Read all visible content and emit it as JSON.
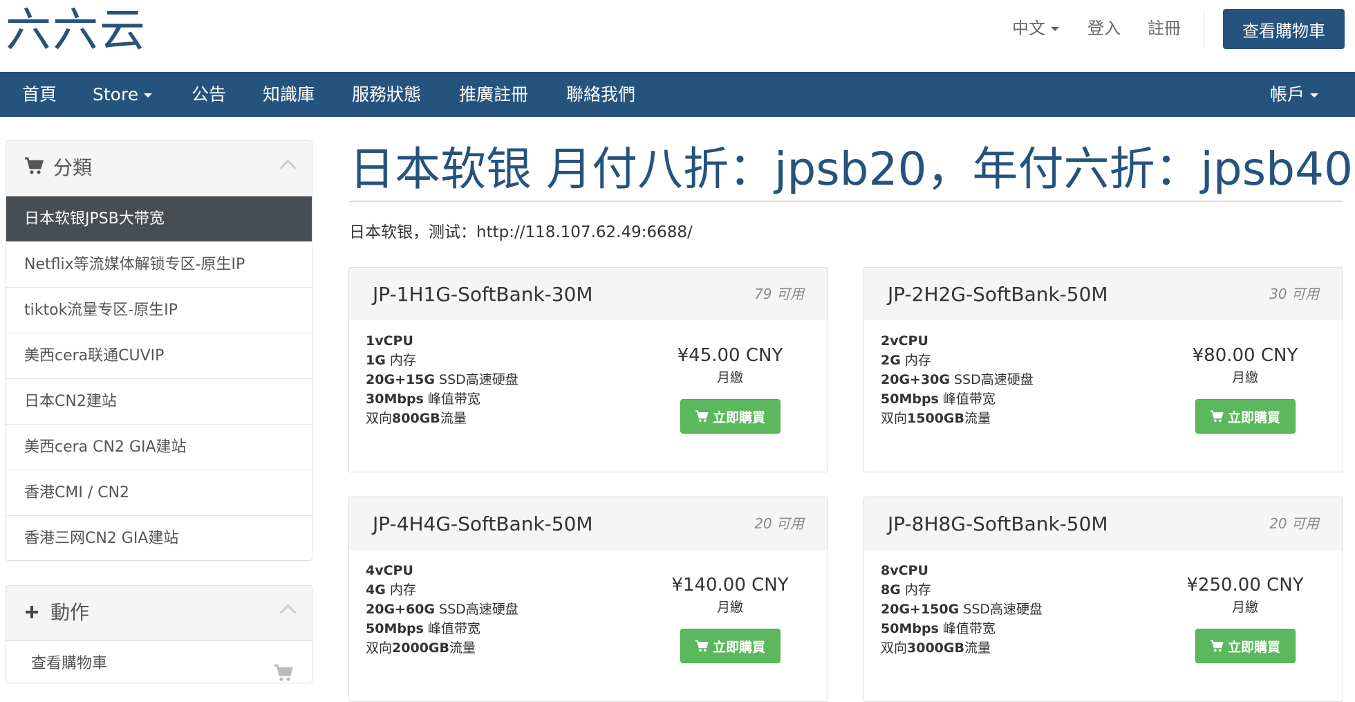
{
  "header": {
    "logo": "六六云",
    "language": "中文",
    "login": "登入",
    "register": "註冊",
    "view_cart": "查看購物車"
  },
  "nav": {
    "items": [
      "首頁",
      "Store",
      "公告",
      "知識庫",
      "服務狀態",
      "推廣註冊",
      "聯絡我們"
    ],
    "account": "帳戶"
  },
  "sidebar": {
    "categories_title": "分類",
    "categories": [
      "日本软银JPSB大带宽",
      "Netflix等流媒体解锁专区-原生IP",
      "tiktok流量专区-原生IP",
      "美西cera联通CUVIP",
      "日本CN2建站",
      "美西cera CN2 GIA建站",
      "香港CMI / CN2",
      "香港三网CN2 GIA建站"
    ],
    "actions_title": "動作",
    "actions": [
      "查看購物車"
    ]
  },
  "main": {
    "title": "日本软银 月付八折：jpsb20，年付六折：jpsb40",
    "description": "日本软银，测试：http://118.107.62.49:6688/",
    "buy_label": "立即購買",
    "products": [
      {
        "name": "JP-1H1G-SoftBank-30M",
        "qty": "79 可用",
        "features": [
          {
            "b": "1vCPU",
            "t": ""
          },
          {
            "b": "1G",
            "t": " 内存"
          },
          {
            "b": "20G+15G",
            "t": " SSD高速硬盘"
          },
          {
            "b": "30Mbps",
            "t": " 峰值带宽"
          },
          {
            "b": "",
            "t": "双向",
            "b2": "800GB",
            "t2": "流量"
          }
        ],
        "price": "¥45.00 CNY",
        "cycle": "月繳"
      },
      {
        "name": "JP-2H2G-SoftBank-50M",
        "qty": "30 可用",
        "features": [
          {
            "b": "2vCPU",
            "t": ""
          },
          {
            "b": "2G",
            "t": " 内存"
          },
          {
            "b": "20G+30G",
            "t": " SSD高速硬盘"
          },
          {
            "b": "50Mbps",
            "t": " 峰值带宽"
          },
          {
            "b": "",
            "t": "双向",
            "b2": "1500GB",
            "t2": "流量"
          }
        ],
        "price": "¥80.00 CNY",
        "cycle": "月繳"
      },
      {
        "name": "JP-4H4G-SoftBank-50M",
        "qty": "20 可用",
        "features": [
          {
            "b": "4vCPU",
            "t": ""
          },
          {
            "b": "4G",
            "t": " 内存"
          },
          {
            "b": "20G+60G",
            "t": " SSD高速硬盘"
          },
          {
            "b": "50Mbps",
            "t": " 峰值带宽"
          },
          {
            "b": "",
            "t": "双向",
            "b2": "2000GB",
            "t2": "流量"
          }
        ],
        "price": "¥140.00 CNY",
        "cycle": "月繳"
      },
      {
        "name": "JP-8H8G-SoftBank-50M",
        "qty": "20 可用",
        "features": [
          {
            "b": "8vCPU",
            "t": ""
          },
          {
            "b": "8G",
            "t": " 内存"
          },
          {
            "b": "20G+150G",
            "t": " SSD高速硬盘"
          },
          {
            "b": "50Mbps",
            "t": " 峰值带宽"
          },
          {
            "b": "",
            "t": "双向",
            "b2": "3000GB",
            "t2": "流量"
          }
        ],
        "price": "¥250.00 CNY",
        "cycle": "月繳"
      }
    ]
  },
  "colors": {
    "brand": "#26537e",
    "active_category": "#474d51",
    "buy_button": "#5cb85c"
  },
  "icons": [
    "shopping-cart-icon",
    "plus-icon",
    "chevron-up-icon",
    "caret-down-icon"
  ]
}
